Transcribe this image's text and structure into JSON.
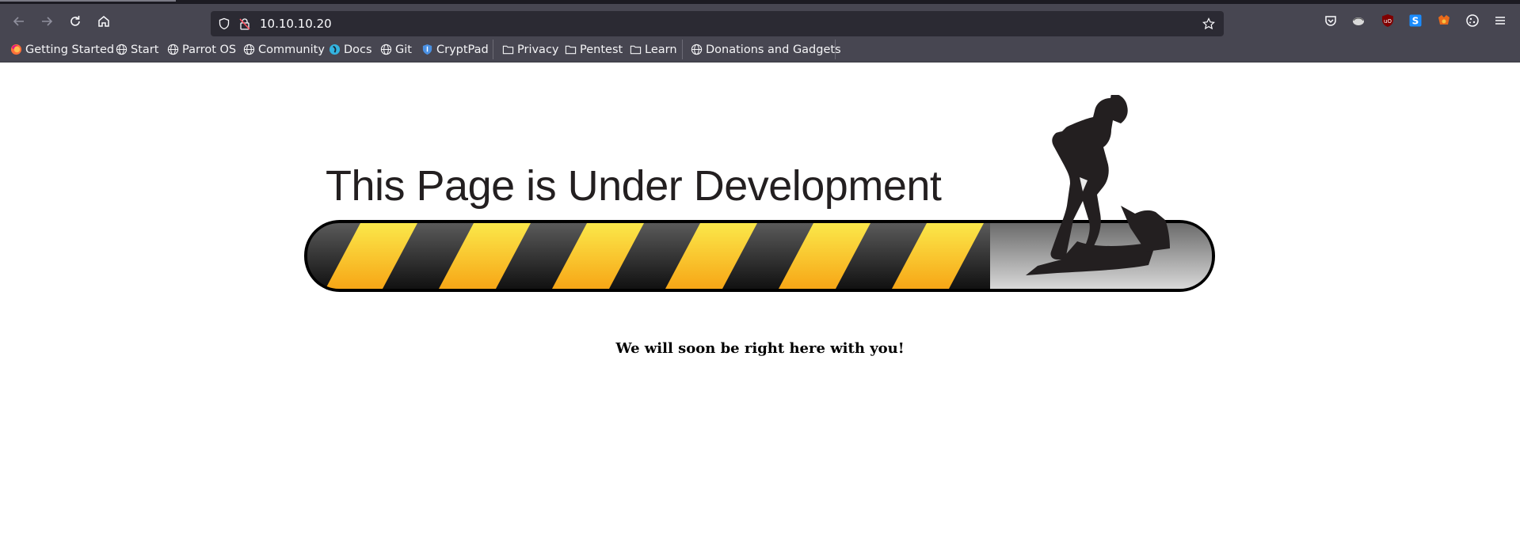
{
  "browser": {
    "url": "10.10.10.20",
    "bookmarks": [
      {
        "label": "Getting Started",
        "icon": "firefox-icon"
      },
      {
        "label": "Start",
        "icon": "globe-icon"
      },
      {
        "label": "Parrot OS",
        "icon": "globe-icon"
      },
      {
        "label": "Community",
        "icon": "globe-icon"
      },
      {
        "label": "Docs",
        "icon": "docs-icon"
      },
      {
        "label": "Git",
        "icon": "globe-icon"
      },
      {
        "label": "CryptPad",
        "icon": "shield-icon"
      },
      {
        "label": "Privacy",
        "icon": "folder-icon"
      },
      {
        "label": "Pentest",
        "icon": "folder-icon"
      },
      {
        "label": "Learn",
        "icon": "folder-icon"
      },
      {
        "label": "Donations and Gadgets",
        "icon": "globe-icon"
      }
    ],
    "extensions": [
      "pocket-icon",
      "extension-icon",
      "ublock-origin-icon",
      "s-extension-icon",
      "foxyproxy-icon",
      "cookie-icon",
      "menu-icon"
    ]
  },
  "page": {
    "title": "This Page is Under Development",
    "message": "We will soon be right here with you!"
  },
  "colors": {
    "chrome_bg": "#474651",
    "url_bg": "#2b2a33",
    "stripe_yellow": "#f7d21c",
    "stripe_dark": "#262626"
  }
}
